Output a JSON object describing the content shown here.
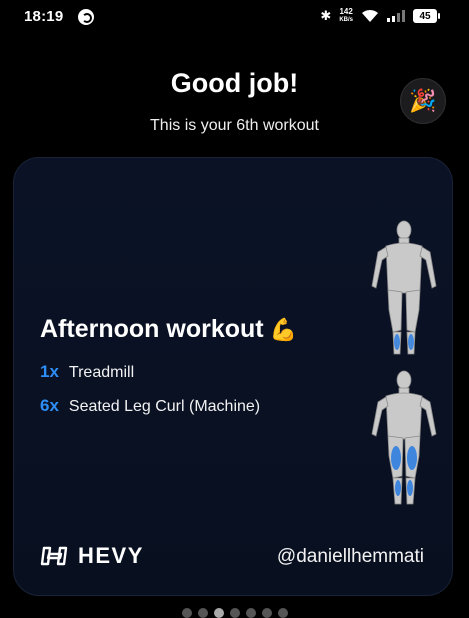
{
  "status_bar": {
    "time": "18:19",
    "net_speed_value": "142",
    "net_speed_unit": "KB/s",
    "battery": "45"
  },
  "header": {
    "title": "Good job!",
    "subtitle": "This is your 6th workout",
    "party_icon": "party-popper-icon"
  },
  "card": {
    "workout_name": "Afternoon workout",
    "workout_emoji": "💪",
    "exercises": [
      {
        "count": "1x",
        "name": "Treadmill"
      },
      {
        "count": "6x",
        "name": "Seated Leg Curl (Machine)"
      }
    ],
    "brand": "HEVY",
    "username": "@daniellhemmati",
    "muscle_highlight_color": "#2f7fe0"
  },
  "pager": {
    "pages": 7,
    "active_index": 2
  }
}
